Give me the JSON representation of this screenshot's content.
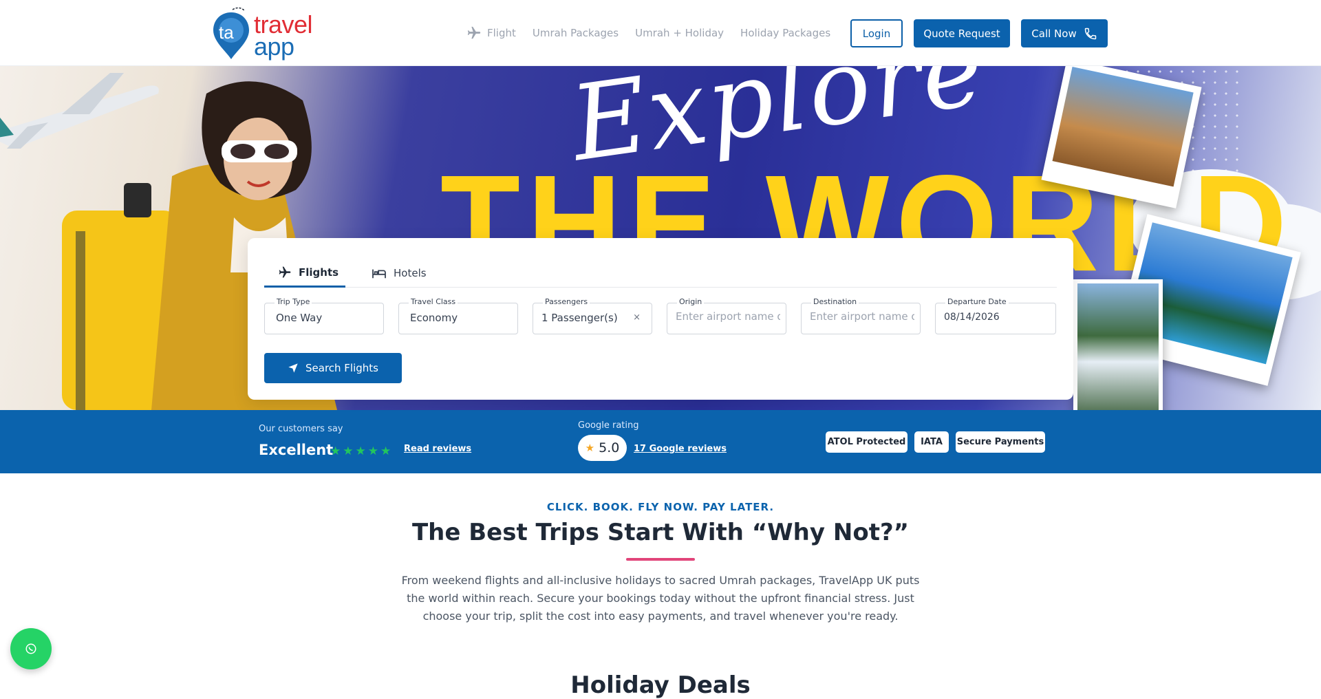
{
  "header": {
    "logo_monogram": "ta",
    "logo_line1": "travel",
    "logo_line2": "app",
    "nav": [
      "Flight",
      "Umrah Packages",
      "Umrah + Holiday",
      "Holiday Packages"
    ],
    "login": "Login",
    "quote": "Quote Request",
    "call": "Call Now"
  },
  "hero": {
    "script_title": "Explore",
    "block_title": "THE WORLD"
  },
  "search": {
    "tabs": [
      "Flights",
      "Hotels"
    ],
    "trip_type": {
      "label": "Trip Type",
      "value": "One Way"
    },
    "travel_class": {
      "label": "Travel Class",
      "value": "Economy"
    },
    "passengers": {
      "label": "Passengers",
      "value": "1 Passenger(s)",
      "clear": "×"
    },
    "origin": {
      "label": "Origin",
      "placeholder": "Enter airport name or"
    },
    "destination": {
      "label": "Destination",
      "placeholder": "Enter airport name or"
    },
    "departure": {
      "label": "Departure Date",
      "value": "08/14/2026"
    },
    "submit": "Search Flights"
  },
  "trust": {
    "customers_say": "Our customers say",
    "excellent": "Excellent",
    "stars": 5,
    "read_reviews": "Read reviews",
    "google_rating_label": "Google rating",
    "google_rating": "5.0",
    "google_reviews": "17 Google reviews",
    "badges": [
      "ATOL Protected",
      "IATA",
      "Secure Payments"
    ]
  },
  "intro": {
    "eyebrow": "CLICK. BOOK. FLY NOW. PAY LATER.",
    "heading": "The Best Trips Start With “Why Not?”",
    "paragraph": "From weekend flights and all-inclusive holidays to sacred Umrah packages, TravelApp UK puts the world within reach. Secure your bookings today without the upfront financial stress. Just choose your trip, split the cost into easy payments, and travel whenever you're ready.",
    "next_heading": "Holiday Deals"
  },
  "colors": {
    "brand_blue": "#0b62ad",
    "brand_red": "#e12d35",
    "accent_pink": "#e1457a",
    "star_green": "#22c55e",
    "whatsapp_green": "#25d366"
  }
}
